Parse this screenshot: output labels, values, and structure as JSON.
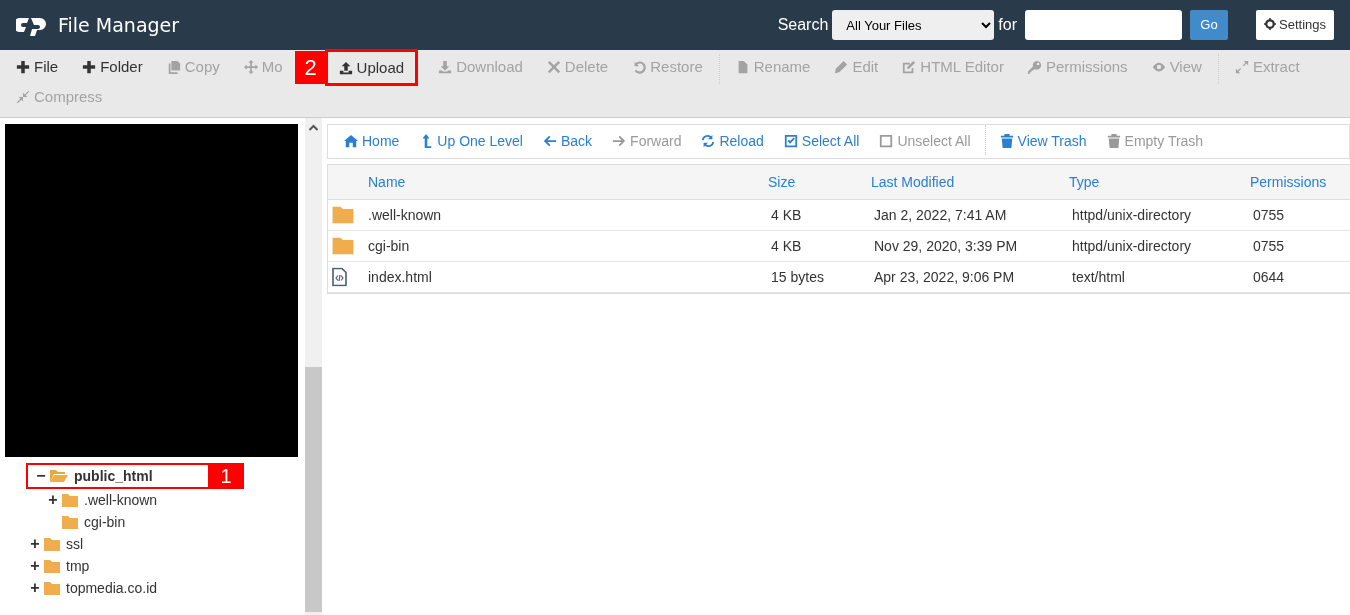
{
  "header": {
    "title": "File Manager",
    "search_label": "Search",
    "scope": "All Your Files",
    "for_label": "for",
    "go": "Go",
    "settings": "Settings"
  },
  "toolbar": [
    {
      "kind": "plus",
      "label": "File",
      "disabled": false
    },
    {
      "kind": "plus",
      "label": "Folder",
      "disabled": false
    },
    {
      "kind": "copy",
      "label": "Copy",
      "disabled": true
    },
    {
      "kind": "move",
      "label": "Mo",
      "disabled": true
    },
    {
      "kind": "upload",
      "label": "Upload",
      "disabled": false,
      "callout": "2"
    },
    {
      "kind": "download",
      "label": "Download",
      "disabled": true
    },
    {
      "kind": "times",
      "label": "Delete",
      "disabled": true
    },
    {
      "kind": "restore",
      "label": "Restore",
      "disabled": true
    },
    {
      "kind": "separator"
    },
    {
      "kind": "file",
      "label": "Rename",
      "disabled": true
    },
    {
      "kind": "pencil",
      "label": "Edit",
      "disabled": true
    },
    {
      "kind": "edit",
      "label": "HTML Editor",
      "disabled": true
    },
    {
      "kind": "key",
      "label": "Permissions",
      "disabled": true
    },
    {
      "kind": "eye",
      "label": "View",
      "disabled": true
    },
    {
      "kind": "separator"
    },
    {
      "kind": "expand",
      "label": "Extract",
      "disabled": true
    },
    {
      "kind": "compress",
      "label": "Compress",
      "disabled": true
    }
  ],
  "tree": [
    {
      "label": "public_html",
      "toggle": "−",
      "expanded": true,
      "selected": true,
      "callout": "1",
      "children": [
        {
          "label": ".well-known",
          "toggle": "+",
          "expanded": false,
          "selected": false
        },
        {
          "label": "cgi-bin",
          "expanded": false,
          "selected": false
        }
      ]
    },
    {
      "label": "ssl",
      "toggle": "+",
      "expanded": false,
      "selected": false
    },
    {
      "label": "tmp",
      "toggle": "+",
      "expanded": false,
      "selected": false
    },
    {
      "label": "topmedia.co.id",
      "toggle": "+",
      "expanded": false,
      "selected": false
    }
  ],
  "nav": [
    {
      "kind": "home",
      "label": "Home",
      "disabled": false
    },
    {
      "kind": "up",
      "label": "Up One Level",
      "disabled": false
    },
    {
      "kind": "back",
      "label": "Back",
      "disabled": false
    },
    {
      "kind": "forward",
      "label": "Forward",
      "disabled": true
    },
    {
      "kind": "reload",
      "label": "Reload",
      "disabled": false
    },
    {
      "kind": "checksq",
      "label": "Select All",
      "disabled": false
    },
    {
      "kind": "square",
      "label": "Unselect All",
      "disabled": true
    },
    {
      "kind": "separator"
    },
    {
      "kind": "trash",
      "label": "View Trash",
      "disabled": false
    },
    {
      "kind": "trash",
      "label": "Empty Trash",
      "disabled": true
    }
  ],
  "table": {
    "columns": [
      "Name",
      "Size",
      "Last Modified",
      "Type",
      "Permissions"
    ],
    "rows": [
      {
        "kind": "folder",
        "cells": [
          ".well-known",
          "4 KB",
          "Jan 2, 2022, 7:41 AM",
          "httpd/unix-directory",
          "0755"
        ]
      },
      {
        "kind": "folder",
        "cells": [
          "cgi-bin",
          "4 KB",
          "Nov 29, 2020, 3:39 PM",
          "httpd/unix-directory",
          "0755"
        ]
      },
      {
        "kind": "file",
        "cells": [
          "index.html",
          "15 bytes",
          "Apr 23, 2022, 9:06 PM",
          "text/html",
          "0644"
        ]
      }
    ]
  }
}
